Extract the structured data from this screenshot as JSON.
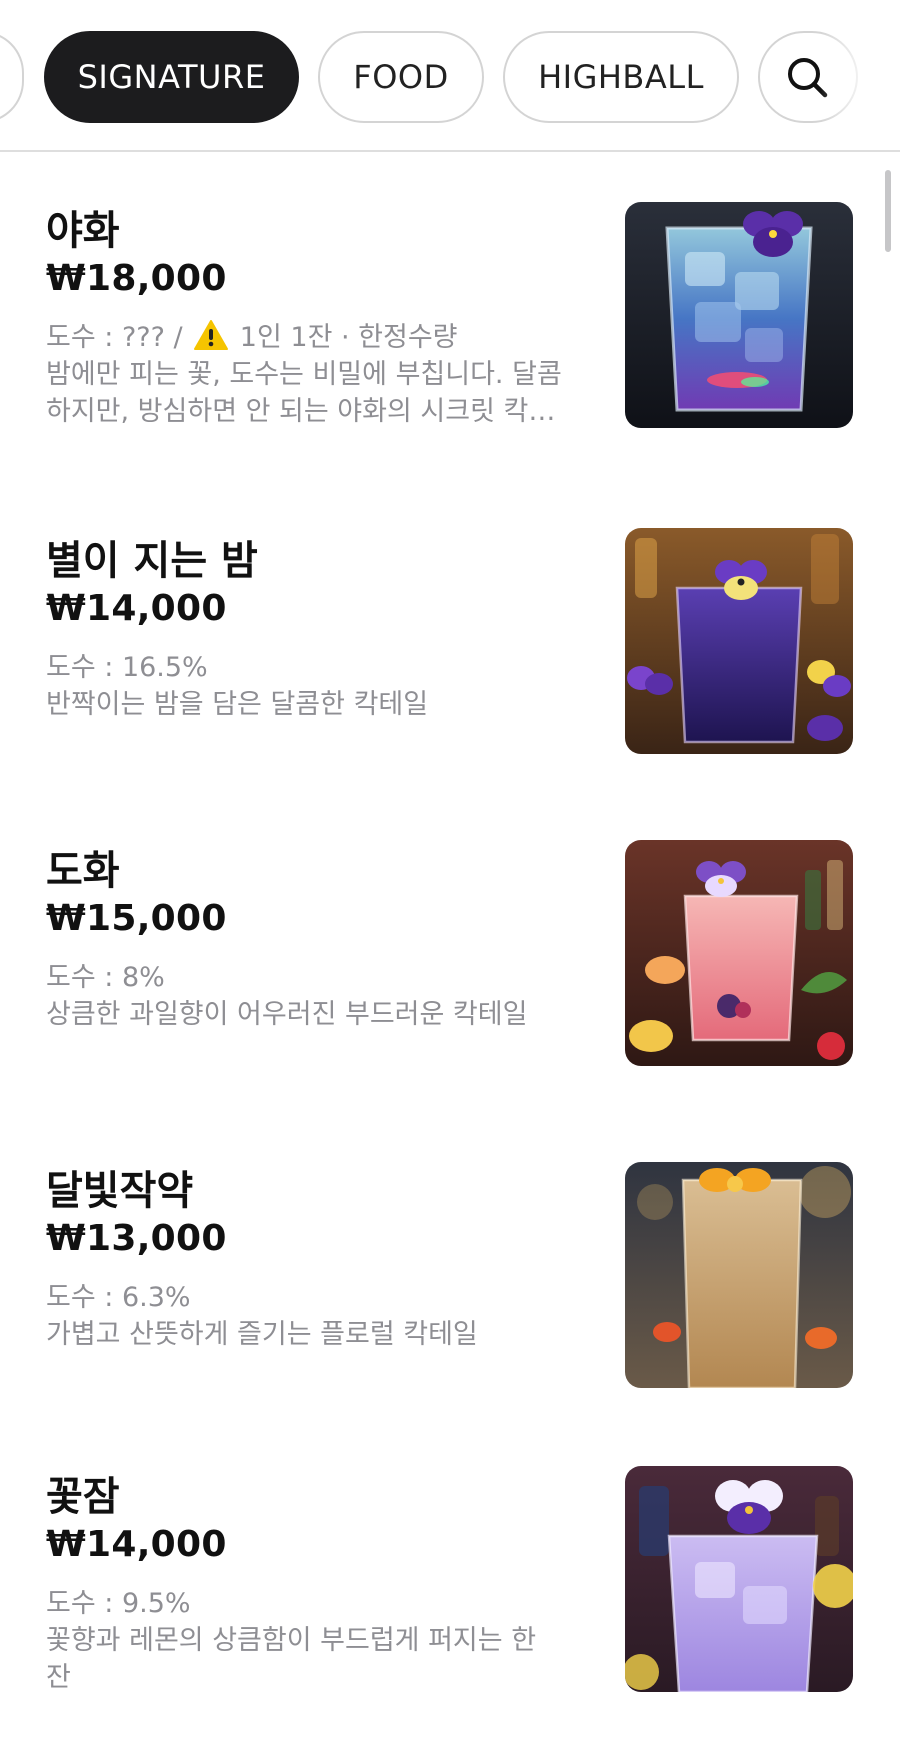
{
  "tabs": {
    "signature": "SIGNATURE",
    "food": "FOOD",
    "highball": "HIGHBALL"
  },
  "icons": {
    "search": "search-icon",
    "warning": "warning-icon"
  },
  "colors": {
    "active_tab": "#1c1c1e",
    "text_primary": "#111111",
    "text_secondary": "#8e8e93",
    "divider": "#dedede"
  },
  "items": [
    {
      "name": "야화",
      "price": "₩18,000",
      "meta_prefix": "도수 : ??? / ",
      "meta_suffix": " 1인 1잔 · 한정수량",
      "description": "밤에만 피는 꽃, 도수는 비밀에 부칩니다. 달콤하지만, 방심하면 안 되는 야화의 시크릿 칵테일"
    },
    {
      "name": "별이 지는 밤",
      "price": "₩14,000",
      "meta": "도수 : 16.5%",
      "description": "반짝이는 밤을 담은 달콤한 칵테일"
    },
    {
      "name": "도화",
      "price": "₩15,000",
      "meta": "도수 : 8%",
      "description": "상큼한 과일향이 어우러진 부드러운 칵테일"
    },
    {
      "name": "달빛작약",
      "price": "₩13,000",
      "meta": "도수 : 6.3%",
      "description": "가볍고 산뜻하게 즐기는 플로럴 칵테일"
    },
    {
      "name": "꽃잠",
      "price": "₩14,000",
      "meta": "도수 : 9.5%",
      "description": "꽃향과 레몬의 상큼함이 부드럽게 퍼지는 한 잔"
    }
  ]
}
